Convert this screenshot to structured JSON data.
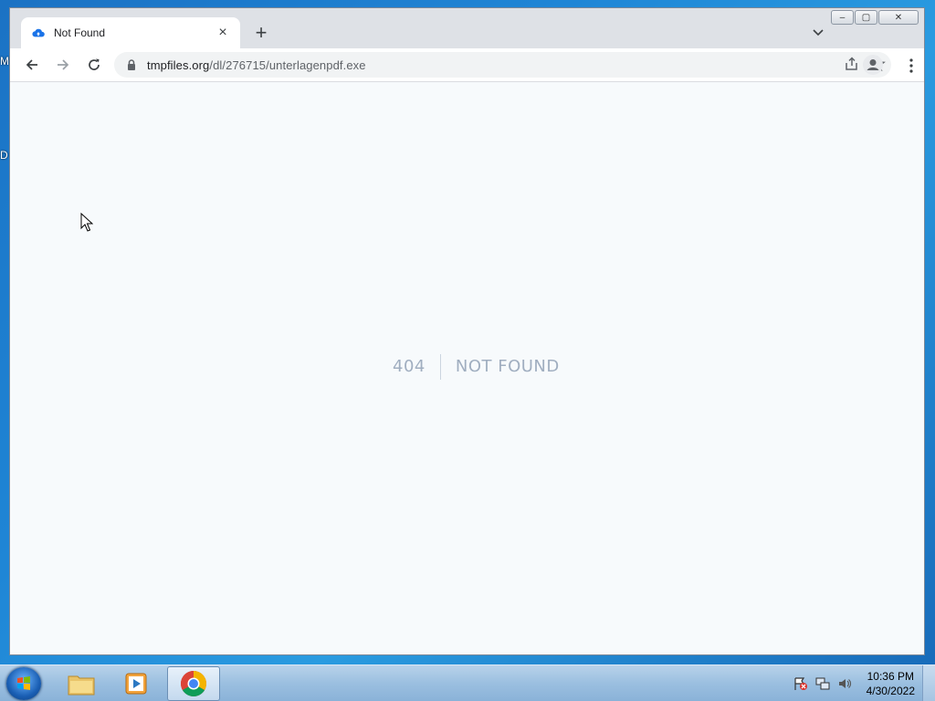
{
  "desktop": {
    "edge_fragments": [
      "M",
      "D"
    ]
  },
  "browser": {
    "tab": {
      "title": "Not Found",
      "close_glyph": "×"
    },
    "new_tab_glyph": "+",
    "omnibox": {
      "url_host": "tmpfiles.org",
      "url_path": "/dl/276715/unterlagenpdf.exe"
    },
    "page": {
      "status_code": "404",
      "message": "NOT FOUND"
    },
    "window_controls": {
      "minimize": "–",
      "maximize": "▢",
      "close": "✕"
    }
  },
  "taskbar": {
    "time": "10:36 PM",
    "date": "4/30/2022"
  },
  "colors": {
    "page_background": "#f7fafc",
    "error_text": "#a0aec0",
    "chrome_frame": "#dee1e6"
  }
}
